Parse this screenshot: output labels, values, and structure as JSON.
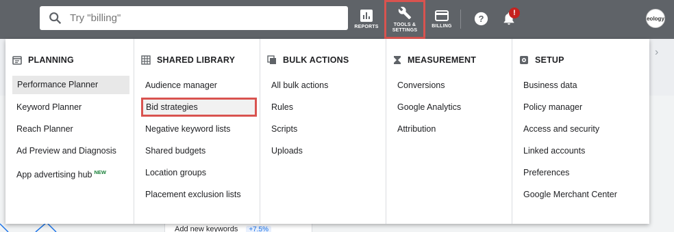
{
  "search": {
    "placeholder": "Try \"billing\""
  },
  "topbar": {
    "reports_label": "REPORTS",
    "tools_label_line1": "TOOLS &",
    "tools_label_line2": "SETTINGS",
    "billing_label": "BILLING",
    "notification_count": "!",
    "avatar_text": "eology"
  },
  "menu": {
    "columns": [
      {
        "heading": "PLANNING",
        "icon": "calendar-icon",
        "items": [
          "Performance Planner",
          "Keyword Planner",
          "Reach Planner",
          "Ad Preview and Diagnosis",
          "App advertising hub"
        ],
        "badge": "NEW"
      },
      {
        "heading": "SHARED LIBRARY",
        "icon": "library-grid-icon",
        "items": [
          "Audience manager",
          "Bid strategies",
          "Negative keyword lists",
          "Shared budgets",
          "Location groups",
          "Placement exclusion lists"
        ]
      },
      {
        "heading": "BULK ACTIONS",
        "icon": "copy-stack-icon",
        "items": [
          "All bulk actions",
          "Rules",
          "Scripts",
          "Uploads"
        ]
      },
      {
        "heading": "MEASUREMENT",
        "icon": "hourglass-icon",
        "items": [
          "Conversions",
          "Google Analytics",
          "Attribution"
        ]
      },
      {
        "heading": "SETUP",
        "icon": "gear-icon",
        "items": [
          "Business data",
          "Policy manager",
          "Access and security",
          "Linked accounts",
          "Preferences",
          "Google Merchant Center"
        ]
      }
    ]
  },
  "background": {
    "row_label": "Add new keywords",
    "row_value": "+7.5%"
  },
  "colors": {
    "topbar": "#5f6368",
    "highlight_border": "#d9534f",
    "new_badge": "#188038"
  }
}
